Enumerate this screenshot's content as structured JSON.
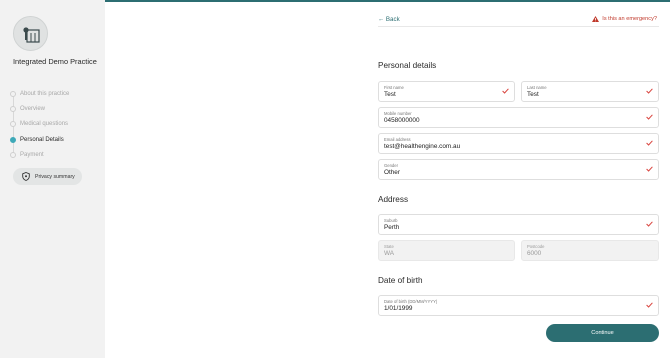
{
  "practice": {
    "name": "Integrated Demo Practice",
    "logo": "clinic-building-icon"
  },
  "steps": [
    {
      "label": "About this practice",
      "state": "pending"
    },
    {
      "label": "Overview",
      "state": "pending"
    },
    {
      "label": "Medical questions",
      "state": "pending"
    },
    {
      "label": "Personal Details",
      "state": "active"
    },
    {
      "label": "Payment",
      "state": "pending"
    }
  ],
  "privacy": {
    "label": "Privacy summary",
    "icon": "shield-icon"
  },
  "nav": {
    "back_label": "← Back",
    "emergency_label": "Is this an emergency?"
  },
  "sections": {
    "personal": "Personal details",
    "address": "Address",
    "dob": "Date of birth"
  },
  "fields": {
    "first_name": {
      "label": "First name",
      "value": "Test"
    },
    "last_name": {
      "label": "Last name",
      "value": "Test"
    },
    "mobile": {
      "label": "Mobile number",
      "value": "0458000000"
    },
    "email": {
      "label": "Email address",
      "value": "test@healthengine.com.au"
    },
    "gender": {
      "label": "Gender",
      "value": "Other"
    },
    "suburb": {
      "label": "Suburb",
      "value": "Perth"
    },
    "state": {
      "label": "State",
      "value": "WA"
    },
    "postcode": {
      "label": "Postcode",
      "value": "6000"
    },
    "dob": {
      "label": "Date of birth (DD/MM/YYYY)",
      "value": "1/01/1999"
    }
  },
  "continue_label": "Continue",
  "colors": {
    "accent": "#2c6e72",
    "active_step": "#3ea9b8",
    "check": "#d9453f",
    "emergency": "#c0392b"
  }
}
